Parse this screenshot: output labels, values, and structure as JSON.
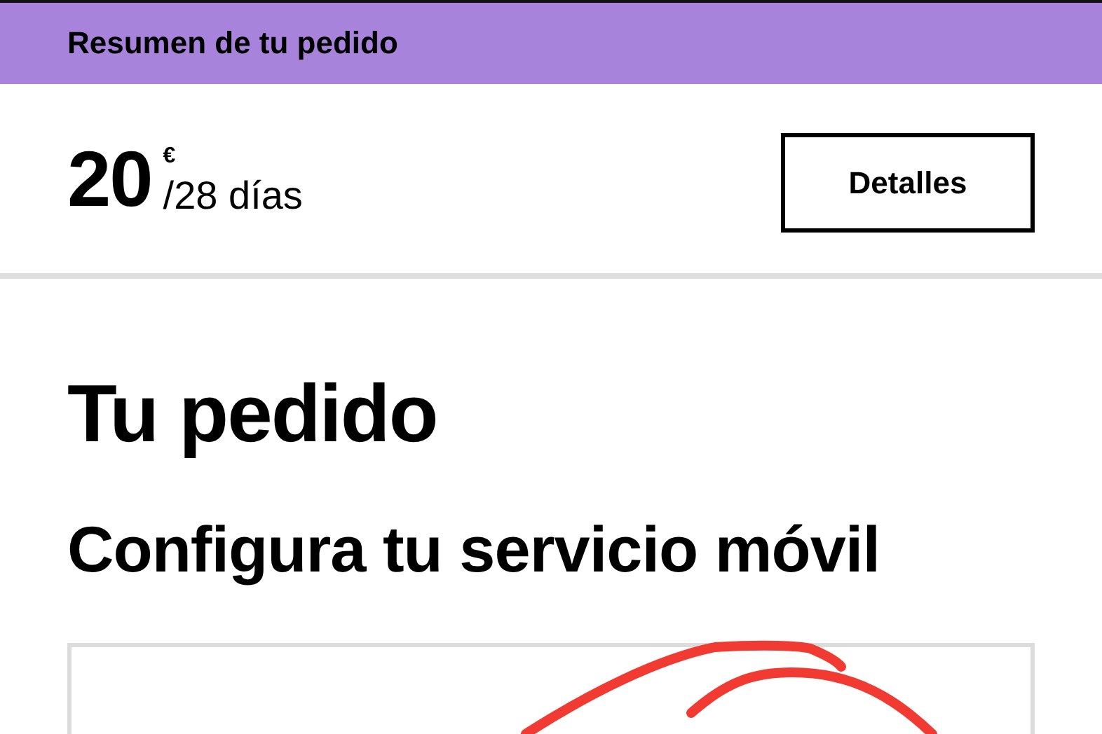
{
  "header": {
    "title": "Resumen de tu pedido"
  },
  "price": {
    "amount": "20",
    "currency": "€",
    "period": "/28 días"
  },
  "details_button": {
    "label": "Detalles"
  },
  "page_title": "Tu pedido",
  "section_title": "Configura tu servicio móvil"
}
